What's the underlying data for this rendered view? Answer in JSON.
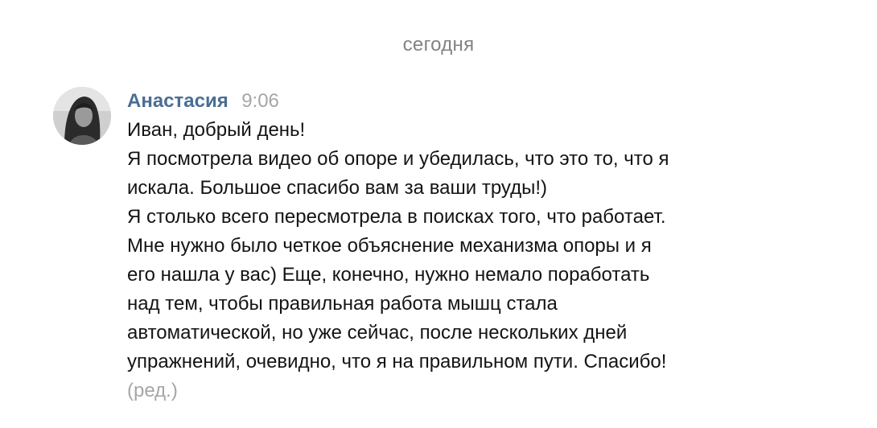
{
  "date_divider": "сегодня",
  "message": {
    "author": "Анастасия",
    "time": "9:06",
    "lines": [
      "Иван, добрый день!",
      "Я посмотрела видео об опоре и убедилась, что это то, что я",
      "искала. Большое спасибо вам за ваши труды!)",
      "Я столько всего пересмотрела в поисках того, что работает.",
      "Мне нужно было четкое объяснение механизма опоры и я",
      "его нашла у вас) Еще, конечно, нужно немало поработать",
      "над тем, чтобы правильная работа мышц стала",
      "автоматической, но уже сейчас, после нескольких дней",
      "упражнений, очевидно, что я на правильном пути. Спасибо!"
    ],
    "edited_label": "(ред.)"
  },
  "colors": {
    "author": "#4a6e93",
    "muted": "#a6a6a6",
    "text": "#141414"
  }
}
